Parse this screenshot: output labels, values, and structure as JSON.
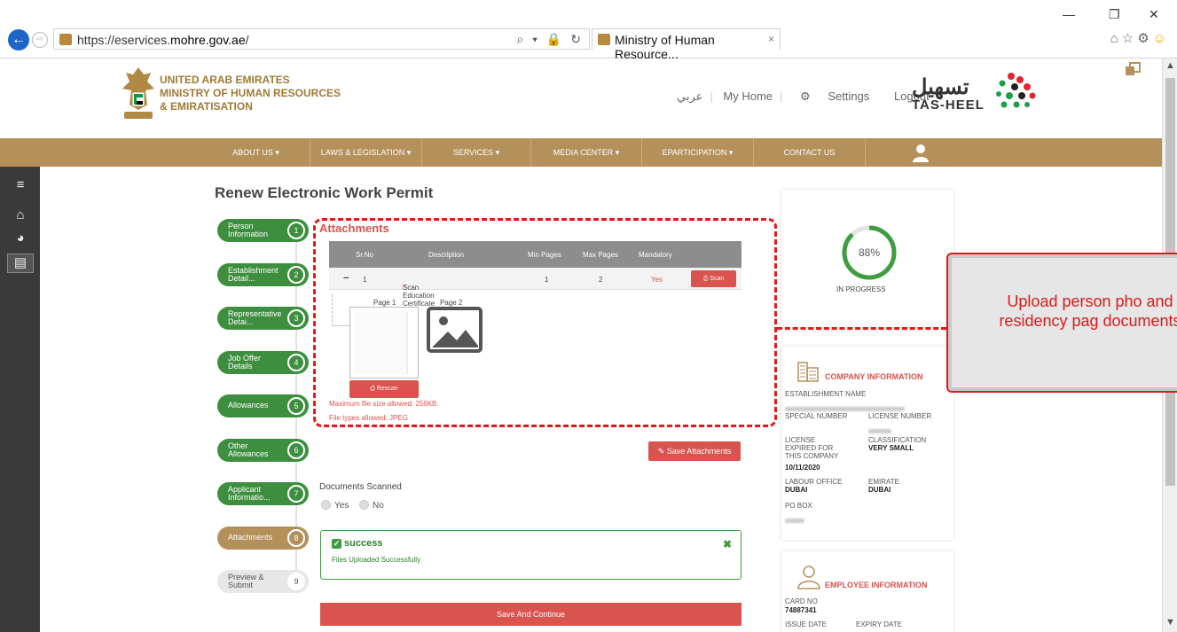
{
  "browser": {
    "url_prefix": "https://eservices.",
    "url_domain": "mohre.gov.ae",
    "url_suffix": "/",
    "tab_title": "Ministry of Human Resource...",
    "tab_close": "×",
    "address_icons": "⌕ ▾ 🔒 ↻"
  },
  "header": {
    "brand_line1": "UNITED ARAB EMIRATES",
    "brand_line2": "MINISTRY OF HUMAN RESOURCES",
    "brand_line3": "& EMIRATISATION",
    "link_arabic": "عربي",
    "link_home": "My Home",
    "link_settings": "Settings",
    "link_logout": "Logout",
    "tasheel_ar": "تسهيل",
    "tasheel_en": "TAS-HEEL"
  },
  "nav": {
    "items": [
      "ABOUT US ▾",
      "LAWS & LEGISLATION ▾",
      "SERVICES ▾",
      "MEDIA CENTER ▾",
      "EPARTICIPATION ▾",
      "CONTACT US"
    ]
  },
  "page": {
    "title": "Renew Electronic Work Permit"
  },
  "steps": [
    {
      "label": "Person Information",
      "num": "1",
      "state": "done"
    },
    {
      "label": "Establishment Detail...",
      "num": "2",
      "state": "done"
    },
    {
      "label": "Representative Detai...",
      "num": "3",
      "state": "done"
    },
    {
      "label": "Job Offer Details",
      "num": "4",
      "state": "done"
    },
    {
      "label": "Allowances",
      "num": "5",
      "state": "done"
    },
    {
      "label": "Other Allowances",
      "num": "6",
      "state": "done"
    },
    {
      "label": "Applicant Informatio...",
      "num": "7",
      "state": "done"
    },
    {
      "label": "Attachments",
      "num": "8",
      "state": "current"
    },
    {
      "label": "Preview & Submit",
      "num": "9",
      "state": "pending"
    }
  ],
  "attachments": {
    "title": "Attachments",
    "columns": [
      "Sr.No",
      "Description",
      "Min Pages",
      "Max Pages",
      "Mandatory"
    ],
    "row": {
      "toggle": "−",
      "sr": "1",
      "description": "Scan Education Certificate",
      "required_mark": "*",
      "min": "1",
      "max": "2",
      "mandatory": "Yes",
      "scan_label": "Scan"
    },
    "page1_label": "Page 1",
    "page2_label": "Page 2",
    "rescan_label": "Rescan",
    "max_size_note": "Maximum file size allowed: 256KB.",
    "file_types_note": "File types allowed: JPEG",
    "save_label": "Save Attachments"
  },
  "documents": {
    "label": "Documents Scanned",
    "yes": "Yes",
    "no": "No"
  },
  "alert": {
    "title": "success",
    "message": "Files Uploaded Successfully",
    "close": "✖"
  },
  "save_continue": "Save And Continue",
  "progress": {
    "percent": "88%",
    "value": 0.88,
    "status": "IN PROGRESS"
  },
  "company": {
    "title": "COMPANY INFORMATION",
    "establishment_name_label": "ESTABLISHMENT NAME",
    "special_number_label": "SPECIAL NUMBER",
    "license_number_label": "LICENSE NUMBER",
    "license_expired_label": "LICENSE EXPIRED FOR THIS COMPANY",
    "license_expired_value": "10/11/2020",
    "classification_label": "CLASSIFICATION",
    "classification_value": "VERY SMALL",
    "labour_office_label": "LABOUR OFFICE",
    "labour_office_value": "DUBAI",
    "emirate_label": "EMIRATE",
    "emirate_value": "DUBAI",
    "po_box_label": "PO BOX"
  },
  "employee": {
    "title": "EMPLOYEE INFORMATION",
    "card_no_label": "CARD NO",
    "card_no_value": "74887341",
    "issue_date_label": "ISSUE DATE",
    "expiry_date_label": "EXPIRY DATE"
  },
  "callout": {
    "text": "Upload person pho and residency pag documents"
  },
  "colors": {
    "gold": "#b4915b",
    "green": "#3d8f3f",
    "red": "#d9534f",
    "annotation_red": "#e01919"
  }
}
